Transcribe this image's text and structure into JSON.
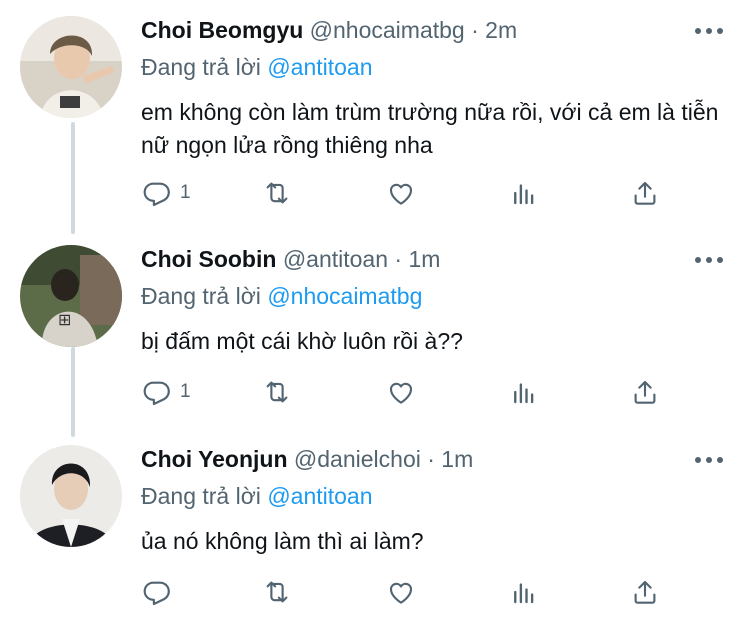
{
  "tweets": [
    {
      "name": "Choi Beomgyu",
      "handle": "@nhocaimatbg",
      "time": "· 2m",
      "reply_prefix": "Đang trả lời",
      "reply_to": "@antitoan",
      "text": "em không còn làm trùm trường nữa rồi, với cả em là tiễn nữ ngọn lửa rồng thiêng nha",
      "reply_count": "1",
      "avatar_colors": [
        "#cfc6b8",
        "#8b7d6b"
      ]
    },
    {
      "name": "Choi Soobin",
      "handle": "@antitoan",
      "time": "· 1m",
      "reply_prefix": "Đang trả lời",
      "reply_to": "@nhocaimatbg",
      "text": "bị đấm một cái khờ luôn rồi à??",
      "reply_count": "1",
      "avatar_colors": [
        "#5f6e4c",
        "#c9c4bb"
      ]
    },
    {
      "name": "Choi Yeonjun",
      "handle": "@danielchoi",
      "time": "· 1m",
      "reply_prefix": "Đang trả lời",
      "reply_to": "@antitoan",
      "text": "ủa nó không làm thì ai làm?",
      "reply_count": "",
      "avatar_colors": [
        "#e9e6e2",
        "#1f1f24"
      ]
    }
  ],
  "icons": {
    "reply": "reply-icon",
    "retweet": "retweet-icon",
    "like": "heart-icon",
    "analytics": "analytics-icon",
    "share": "share-icon",
    "more": "more-dots-icon"
  },
  "colors": {
    "link": "#1d9bf0",
    "secondary": "#536471",
    "thread_line": "#cfd9de"
  }
}
